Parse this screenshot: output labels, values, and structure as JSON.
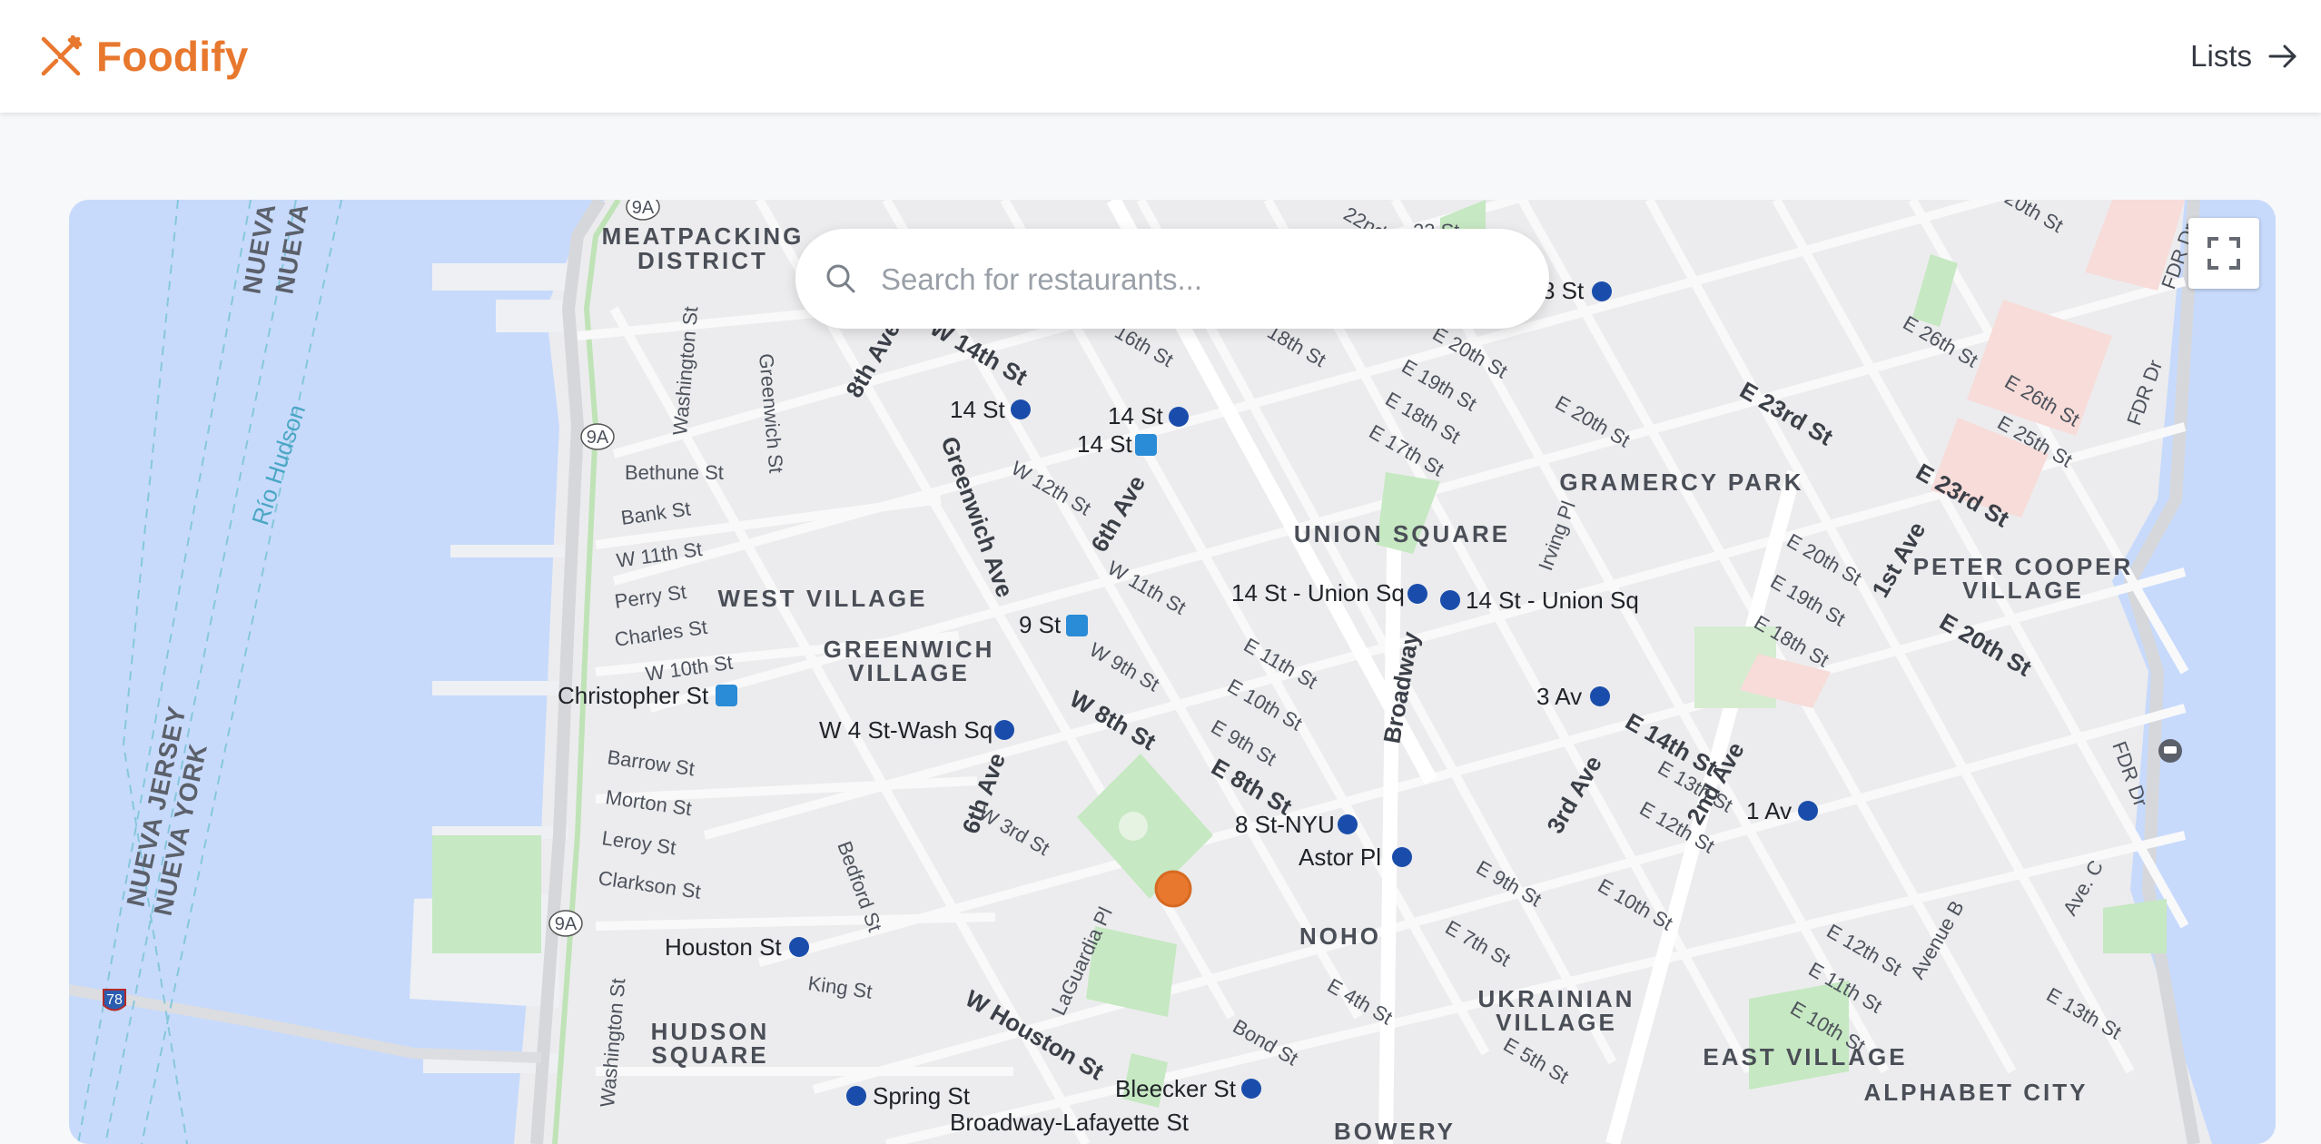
{
  "header": {
    "brand": "Foodify",
    "lists_label": "Lists"
  },
  "search": {
    "placeholder": "Search for restaurants..."
  },
  "icons": {
    "logo": "fork-knife-icon",
    "nav": "arrow-right-icon",
    "search": "search-icon",
    "fullscreen": "fullscreen-icon",
    "selected_location": "location-dot-icon"
  },
  "colors": {
    "brand": "#e8782e",
    "marker": "#e8782e",
    "water": "#c7dafc",
    "park": "#c6e8c2",
    "transit": "#1a4dab"
  },
  "map": {
    "neighborhoods": [
      "MEATPACKING",
      "DISTRICT",
      "WEST VILLAGE",
      "GREENWICH",
      "VILLAGE",
      "UNION SQUARE",
      "GRAMERCY PARK",
      "PETER COOPER",
      "VILLAGE",
      "NOHO",
      "UKRAINIAN",
      "VILLAGE",
      "HUDSON",
      "SQUARE",
      "EAST VILLAGE",
      "ALPHABET CITY",
      "BOWERY"
    ],
    "stations": [
      "14 St",
      "14 St",
      "14 St",
      "9 St",
      "14 St - Union Sq",
      "14 St - Union Sq",
      "Christopher St",
      "W 4 St-Wash Sq",
      "3 Av",
      "8 St-NYU",
      "Astor Pl",
      "1 Av",
      "Houston St",
      "Spring St",
      "Bleecker St",
      "Broadway-Lafayette St",
      "3 St"
    ],
    "streets": [
      "22nd St",
      "23 St",
      "20th St",
      "16th St",
      "18th St",
      "E 20th St",
      "E 19th St",
      "E 18th St",
      "E 17th St",
      "E 20th St",
      "E 23rd St",
      "E 26th St",
      "E 26th St",
      "E 25th St",
      "E 23rd St",
      "FDR Dr",
      "FDR Dr",
      "FDR Dr",
      "W 14th St",
      "8th Ave",
      "Greenwich St",
      "Washington St",
      "Bethune St",
      "Bank St",
      "W 11th St",
      "Perry St",
      "Charles St",
      "W 10th St",
      "W 12th St",
      "Greenwich Ave",
      "6th Ave",
      "W 11th St",
      "W 9th St",
      "W 8th St",
      "E 11th St",
      "E 10th St",
      "E 9th St",
      "E 8th St",
      "Broadway",
      "Irving Pl",
      "3rd Ave",
      "2nd Ave",
      "1st Ave",
      "E 20th St",
      "E 19th St",
      "E 18th St",
      "E 20th St",
      "E 14th St",
      "E 13th St",
      "E 12th St",
      "Barrow St",
      "Morton St",
      "Leroy St",
      "Clarkson St",
      "6th Ave",
      "W 3rd St",
      "Bedford St",
      "King St",
      "W Houston St",
      "LaGuardia Pl",
      "Washington St",
      "E 9th St",
      "E 10th St",
      "E 7th St",
      "E 4th St",
      "E 5th St",
      "Bond St",
      "E 12th St",
      "E 11th St",
      "E 10th St",
      "Avenue B",
      "Ave. C",
      "E 13th St"
    ],
    "water_labels": [
      "Río Hudson"
    ],
    "state_labels": [
      "NUEVA",
      "NUEVA",
      "NUEVA JERSEY",
      "NUEVA YORK"
    ],
    "route_shields": [
      "9A",
      "9A",
      "9A",
      "78"
    ]
  }
}
